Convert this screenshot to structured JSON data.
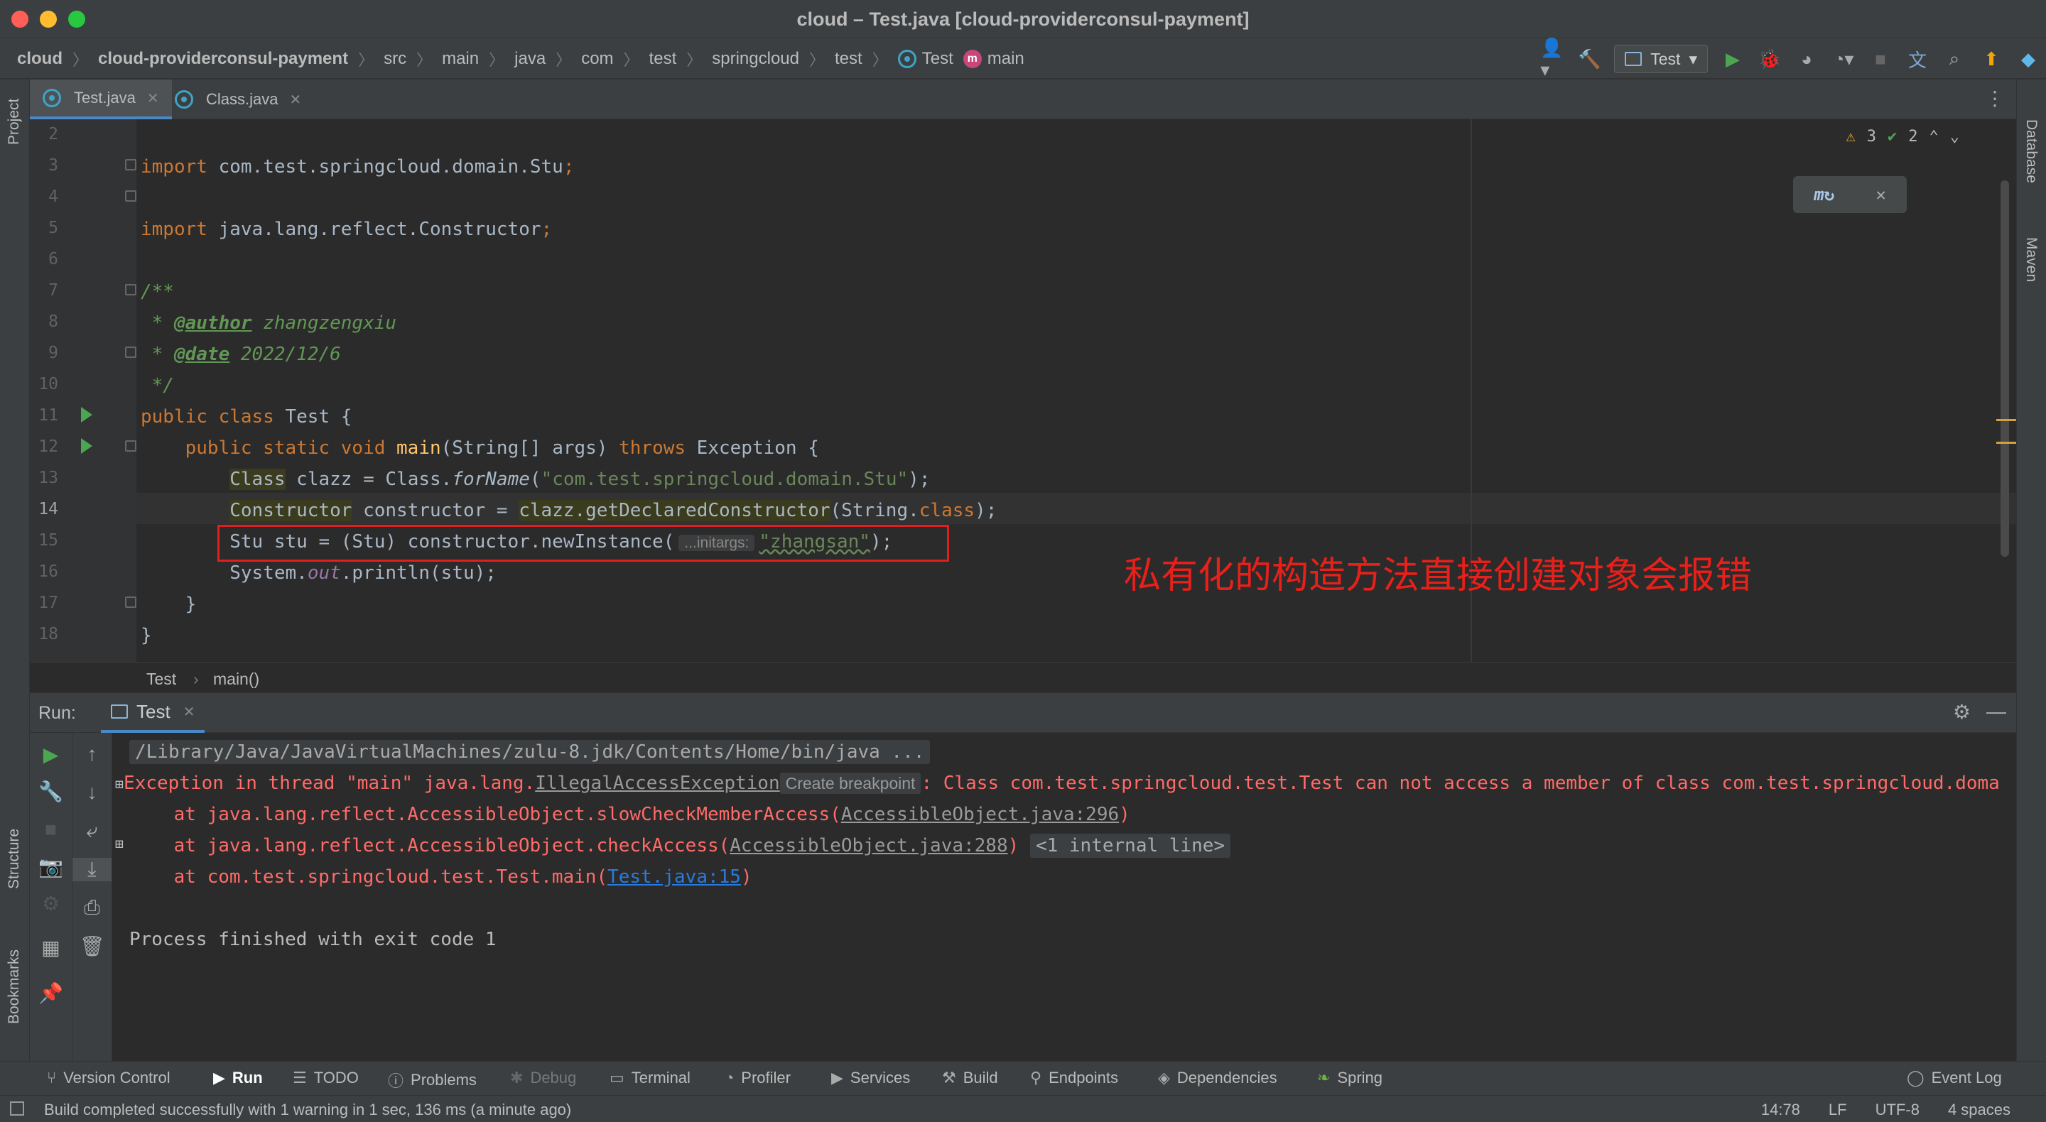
{
  "window": {
    "title": "cloud – Test.java [cloud-providerconsul-payment]",
    "traffic_colors": [
      "#ff5f57",
      "#febc2e",
      "#28c840"
    ]
  },
  "breadcrumbs": [
    "cloud",
    "cloud-providerconsul-payment",
    "src",
    "main",
    "java",
    "com",
    "test",
    "springcloud",
    "test",
    "Test",
    "main"
  ],
  "toolbar": {
    "run_config": "Test",
    "icons": [
      "user-icon",
      "hammer-icon",
      "run-icon",
      "debug-icon",
      "coverage-icon",
      "profile-icon",
      "stop-icon",
      "translate-icon",
      "search-icon",
      "update-icon",
      "jetbrains-icon"
    ]
  },
  "editor_tabs": [
    {
      "label": "Test.java",
      "active": true
    },
    {
      "label": "Class.java",
      "active": false
    }
  ],
  "left_strip": {
    "project": "Project",
    "structure": "Structure",
    "bookmarks": "Bookmarks"
  },
  "right_strip": {
    "database": "Database",
    "maven": "Maven"
  },
  "inspection": {
    "warnings": "3",
    "ok": "2"
  },
  "code": {
    "line_numbers": [
      "2",
      "3",
      "4",
      "5",
      "6",
      "7",
      "8",
      "9",
      "10",
      "11",
      "12",
      "13",
      "14",
      "15",
      "16",
      "17",
      "18"
    ],
    "l3_kw": "import",
    "l3_rest": " com.test.springcloud.domain.Stu",
    "l5_kw": "import",
    "l5_rest": " java.lang.reflect.Constructor",
    "semicolon": ";",
    "l7": "/**",
    "l8_star": " * ",
    "l8_tag": "@author",
    "l8_val": " zhangzengxiu",
    "l9_star": " * ",
    "l9_tag": "@date",
    "l9_val": " 2022/12/6",
    "l10": " */",
    "l11_kw": "public class",
    "l11_rest": " Test {",
    "l12_kw1": "    public static void ",
    "l12_fn": "main",
    "l12_mid": "(String[] args) ",
    "l12_kw2": "throws",
    "l12_rest": " Exception {",
    "l13_indent": "        ",
    "l13_type": "Class",
    "l13_a": " clazz = Class.",
    "l13_fn": "forName",
    "l13_b": "(",
    "l13_str": "\"com.test.springcloud.domain.Stu\"",
    "l13_c": ");",
    "l14_indent": "        ",
    "l14_type": "Constructor",
    "l14_a": " constructor = ",
    "l14_call": "clazz.getDeclaredConstructor",
    "l14_b": "(String.",
    "l14_kw": "class",
    "l14_c": ");",
    "l15_a": "        Stu stu = (Stu) constructor.newInstance(",
    "l15_hint": "...initargs:",
    "l15_str": "\"zhangsan\"",
    "l15_c": ");",
    "l16_a": "        System.",
    "l16_field": "out",
    "l16_b": ".println(stu);",
    "l17": "    }",
    "l18": "}"
  },
  "annotation": "私有化的构造方法直接创建对象会报错",
  "editor_breadcrumb": {
    "class": "Test",
    "method": "main()"
  },
  "run_panel": {
    "label": "Run:",
    "tab": "Test",
    "console": {
      "cmd": "/Library/Java/JavaVirtualMachines/zulu-8.jdk/Contents/Home/bin/java ...",
      "exc_a": "Exception in thread \"main\" java.lang.",
      "exc_link": "IllegalAccessException",
      "exc_chip": "Create breakpoint",
      "exc_b": ": Class com.test.springcloud.test.Test can not access a member of class com.test.springcloud.doma",
      "at1_a": "    at java.lang.reflect.AccessibleObject.slowCheckMemberAccess(",
      "at1_link": "AccessibleObject.java:296",
      "at1_b": ")",
      "at2_a": "    at java.lang.reflect.AccessibleObject.checkAccess(",
      "at2_link": "AccessibleObject.java:288",
      "at2_b": ")",
      "at2_chip": "<1 internal line>",
      "at3_a": "    at com.test.springcloud.test.Test.main(",
      "at3_link": "Test.java:15",
      "at3_b": ")",
      "finished": "Process finished with exit code 1"
    }
  },
  "bottom_tools": [
    "Version Control",
    "Run",
    "TODO",
    "Problems",
    "Debug",
    "Terminal",
    "Profiler",
    "Services",
    "Build",
    "Endpoints",
    "Dependencies",
    "Spring",
    "Event Log"
  ],
  "status": {
    "message": "Build completed successfully with 1 warning in 1 sec, 136 ms (a minute ago)",
    "position": "14:78",
    "line_sep": "LF",
    "encoding": "UTF-8",
    "indent": "4 spaces"
  },
  "colors": {
    "accent": "#4a88c7",
    "error": "#ff6b68",
    "annotation": "#e8201a",
    "run_green": "#4ca651"
  }
}
